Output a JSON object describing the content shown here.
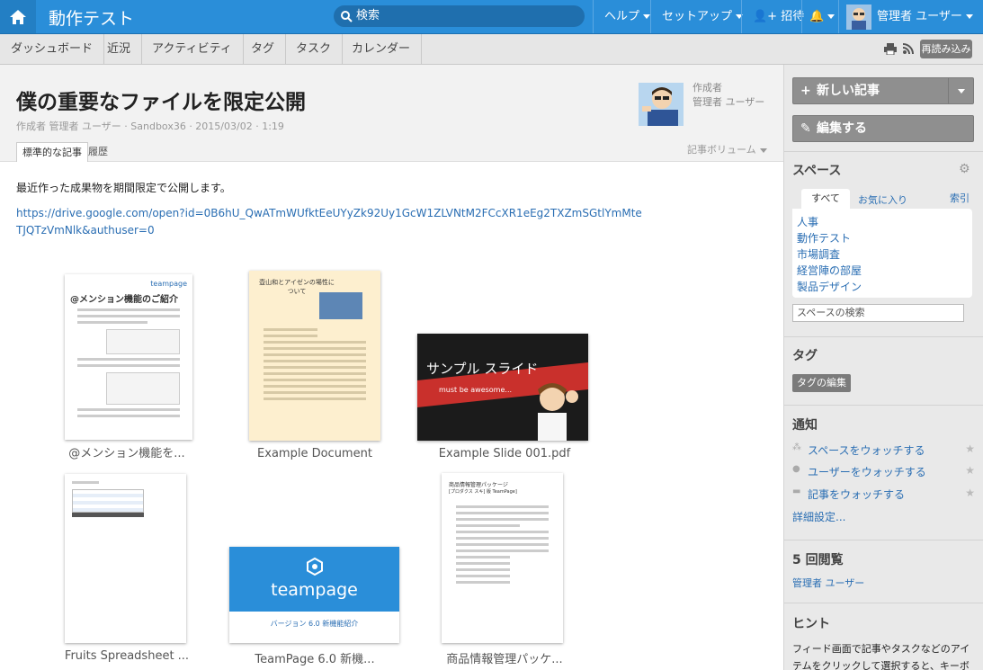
{
  "topbar": {
    "title": "動作テスト",
    "search_placeholder": "検索",
    "help": "ヘルプ",
    "setup": "セットアップ",
    "invite": "招待",
    "user": "管理者 ユーザー"
  },
  "subnav": {
    "items": [
      "ダッシュボード",
      "近況",
      "アクティビティ",
      "タグ",
      "タスク",
      "カレンダー"
    ],
    "reload": "再読み込み"
  },
  "article": {
    "title": "僕の重要なファイルを限定公開",
    "meta": "作成者 管理者 ユーザー · Sandbox36 · 2015/03/02 · 1:19",
    "author_label": "作成者",
    "author_name": "管理者 ユーザー",
    "tab_standard": "標準的な記事",
    "tab_history": "履歴",
    "volume": "記事ボリューム",
    "body": "最近作った成果物を期間限定で公開します。",
    "link": "https://drive.google.com/open?id=0B6hU_QwATmWUfktEeUYyZk92Uy1GcW1ZLVNtM2FCcXR1eEg2TXZmSGtlYmMteTJQTzVmNlk&authuser=0"
  },
  "attachments": [
    {
      "caption": "@メンション機能を...",
      "heading": "@メンション機能のご紹介",
      "brand": "teampage"
    },
    {
      "caption": "Example Document",
      "heading": "壺山和とアイゼンの場性について"
    },
    {
      "caption": "Example Slide 001.pdf",
      "slide_title": "サンプル スライド",
      "slide_sub": "must be awesome..."
    },
    {
      "caption": "Fruits Spreadsheet ..."
    },
    {
      "caption": "TeamPage 6.0 新機...",
      "brand": "teampage",
      "sub": "バージョン 6.0 新機能紹介"
    },
    {
      "caption": "商品情報管理パッケ...",
      "heading": "商品情報管理パッケージ",
      "subheading": "[プロダクス スキ] 版 TeamPage]"
    }
  ],
  "sidebar": {
    "new_article": "新しい記事",
    "edit": "編集する",
    "spaces_title": "スペース",
    "tab_all": "すべて",
    "tab_fav": "お気に入り",
    "index": "索引",
    "spaces": [
      "人事",
      "動作テスト",
      "市場調査",
      "経営陣の部屋",
      "製品デザイン"
    ],
    "space_search": "スペースの検索",
    "tags_title": "タグ",
    "tag_edit": "タグの編集",
    "notify_title": "通知",
    "watch_space": "スペースをウォッチする",
    "watch_user": "ユーザーをウォッチする",
    "watch_article": "記事をウォッチする",
    "detail": "詳細設定...",
    "views_title": "5 回閲覧",
    "viewer": "管理者 ユーザー",
    "hint_title": "ヒント",
    "hint_text": "フィード画面で記事やタスクなどのアイテムをクリックして選択すると、キーボ"
  }
}
